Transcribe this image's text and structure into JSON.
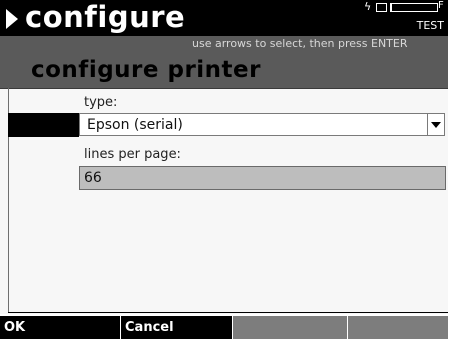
{
  "titlebar": {
    "title": "configure",
    "arrow_icon": "right-triangle-icon",
    "status": {
      "power_icon": "lightning-bolt-icon",
      "plug_icon": "plug-icon",
      "battery_level": 0.02,
      "battery_letter": "F",
      "mode": "TEST"
    }
  },
  "hint": "use arrows to select, then press ENTER",
  "page_title": "configure printer",
  "form": {
    "type_label": "type:",
    "type_value": "Epson (serial)",
    "lines_label": "lines per page:",
    "lines_value": "66"
  },
  "softkeys": [
    {
      "label": "OK"
    },
    {
      "label": "Cancel"
    },
    {
      "label": ""
    },
    {
      "label": ""
    }
  ],
  "colors": {
    "titlebar_bg": "#000000",
    "header_bg": "#5a5a5a",
    "softkey_bg": "#000000",
    "softkey_disabled_bg": "#7d7d7d"
  }
}
